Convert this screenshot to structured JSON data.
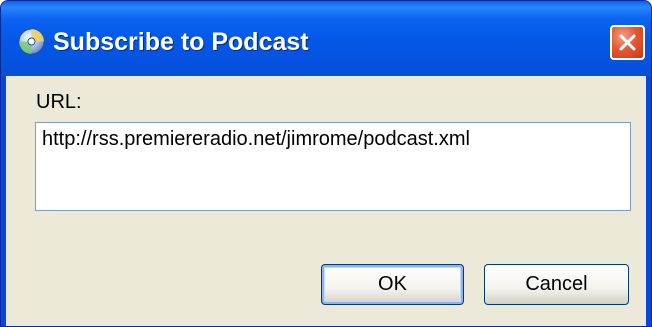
{
  "window": {
    "title": "Subscribe to Podcast",
    "icon": "podcast-disc-icon",
    "close_icon": "close-icon"
  },
  "form": {
    "url_label": "URL:",
    "url_value": "http://rss.premiereradio.net/jimrome/podcast.xml"
  },
  "buttons": {
    "ok_label": "OK",
    "cancel_label": "Cancel"
  },
  "colors": {
    "titlebar": "#0553e0",
    "client_bg": "#ece9d8",
    "close_button": "#e25a34",
    "default_button_focus": "#8cb4f2"
  }
}
